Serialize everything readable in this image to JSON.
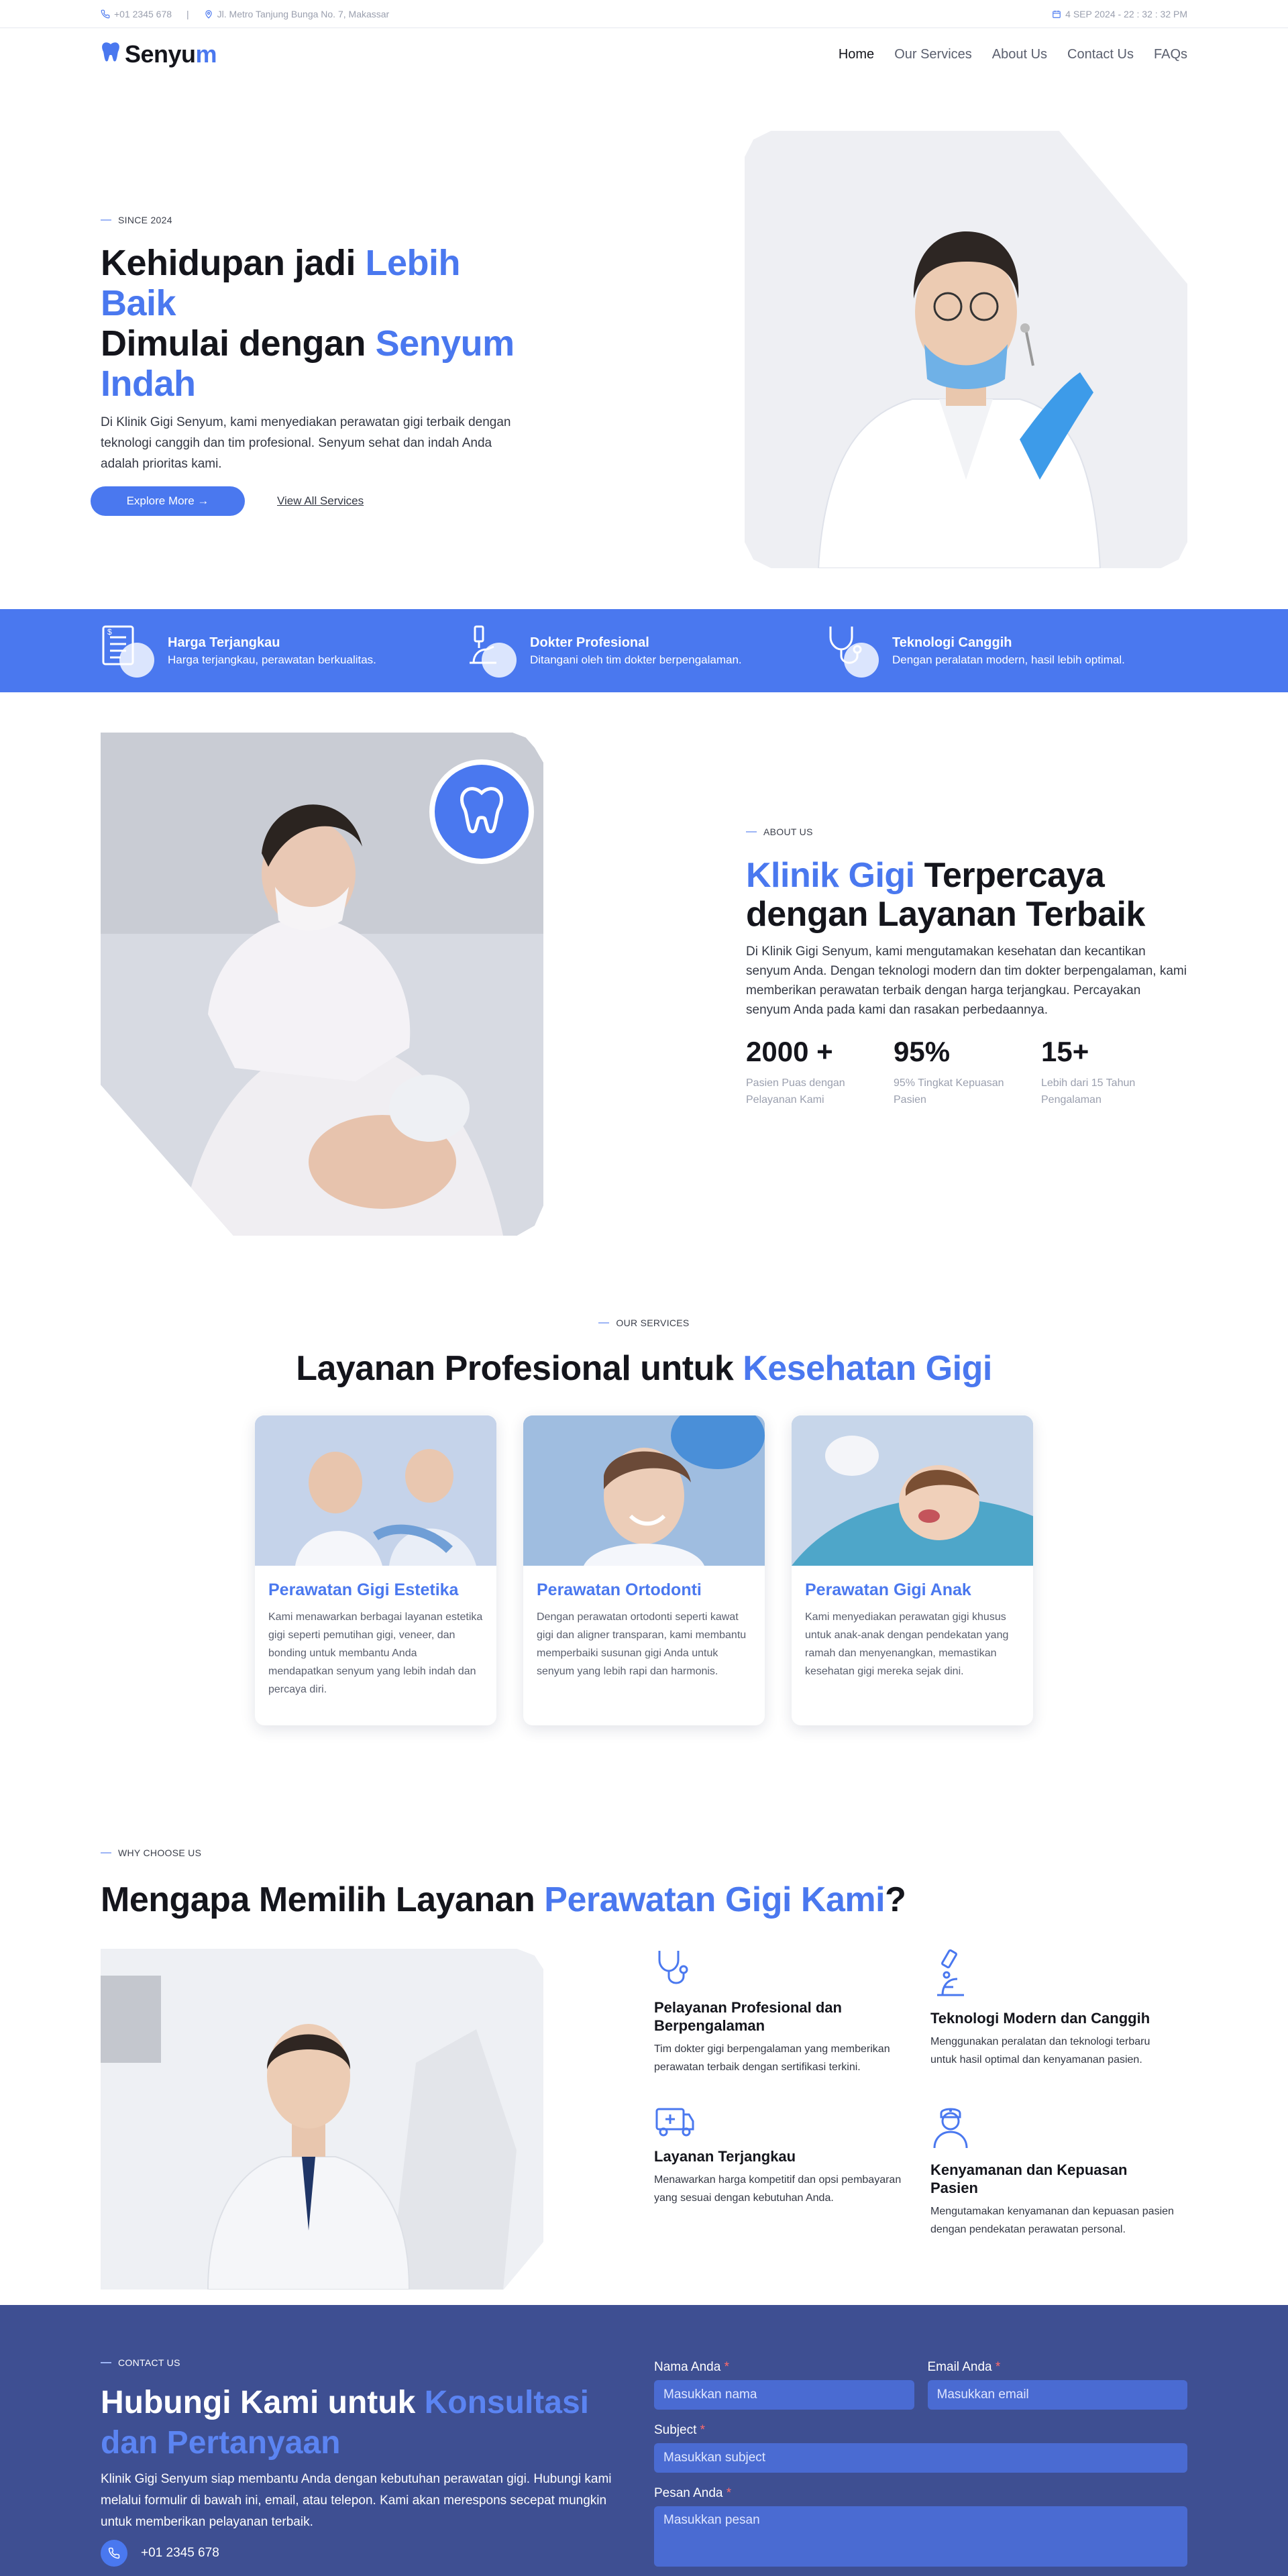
{
  "topbar": {
    "phone": "+01 2345 678",
    "address": "Jl. Metro Tanjung Bunga No. 7, Makassar",
    "datetime": "4 SEP 2024 - 22 : 32 : 32 PM"
  },
  "brand": {
    "name_prefix": "Senyu",
    "name_suffix": "m"
  },
  "nav": {
    "items": [
      "Home",
      "Our Services",
      "About Us",
      "Contact Us",
      "FAQs"
    ]
  },
  "hero": {
    "eyebrow": "SINCE 2024",
    "title_1": "Kehidupan jadi ",
    "title_2": "Lebih Baik",
    "title_3": "Dimulai dengan ",
    "title_4": "Senyum Indah",
    "description": "Di Klinik Gigi Senyum, kami menyediakan perawatan gigi terbaik dengan teknologi canggih dan tim profesional. Senyum sehat dan indah Anda adalah prioritas kami.",
    "primary_button": "Explore More →",
    "secondary_link": "View All Services"
  },
  "features": [
    {
      "title": "Harga Terjangkau",
      "desc": "Harga terjangkau, perawatan berkualitas."
    },
    {
      "title": "Dokter Profesional",
      "desc": "Ditangani oleh tim dokter berpengalaman."
    },
    {
      "title": "Teknologi Canggih",
      "desc": "Dengan peralatan modern, hasil lebih optimal."
    }
  ],
  "about": {
    "eyebrow": "ABOUT US",
    "title_1": "Klinik Gigi",
    "title_2": " Terpercaya dengan Layanan Terbaik",
    "description": "Di Klinik Gigi Senyum, kami mengutamakan kesehatan dan kecantikan senyum Anda. Dengan teknologi modern dan tim dokter berpengalaman, kami memberikan perawatan terbaik dengan harga terjangkau. Percayakan senyum Anda pada kami dan rasakan perbedaannya.",
    "stats": [
      {
        "value": "2000 +",
        "label": "Pasien Puas dengan Pelayanan Kami"
      },
      {
        "value": "95%",
        "label": "95% Tingkat Kepuasan Pasien"
      },
      {
        "value": "15+",
        "label": "Lebih dari 15 Tahun Pengalaman"
      }
    ]
  },
  "services": {
    "eyebrow": "OUR SERVICES",
    "title_1": "Layanan Profesional untuk ",
    "title_2": "Kesehatan Gigi",
    "cards": [
      {
        "title": "Perawatan Gigi Estetika",
        "desc": "Kami menawarkan berbagai layanan estetika gigi seperti pemutihan gigi, veneer, dan bonding untuk membantu Anda mendapatkan senyum yang lebih indah dan percaya diri."
      },
      {
        "title": "Perawatan Ortodonti",
        "desc": "Dengan perawatan ortodonti seperti kawat gigi dan aligner transparan, kami membantu memperbaiki susunan gigi Anda untuk senyum yang lebih rapi dan harmonis."
      },
      {
        "title": "Perawatan Gigi Anak",
        "desc": "Kami menyediakan perawatan gigi khusus untuk anak-anak dengan pendekatan yang ramah dan menyenangkan, memastikan kesehatan gigi mereka sejak dini."
      }
    ]
  },
  "why": {
    "eyebrow": "WHY CHOOSE US",
    "title_1": "Mengapa Memilih Layanan ",
    "title_2": "Perawatan Gigi Kami",
    "title_3": "?",
    "items": [
      {
        "title": "Pelayanan Profesional dan Berpengalaman",
        "desc": "Tim dokter gigi berpengalaman yang memberikan perawatan terbaik dengan sertifikasi terkini."
      },
      {
        "title": "Teknologi Modern dan Canggih",
        "desc": "Menggunakan peralatan dan teknologi terbaru untuk hasil optimal dan kenyamanan pasien."
      },
      {
        "title": "Layanan Terjangkau",
        "desc": "Menawarkan harga kompetitif dan opsi pembayaran yang sesuai dengan kebutuhan Anda."
      },
      {
        "title": "Kenyamanan dan Kepuasan Pasien",
        "desc": "Mengutamakan kenyamanan dan kepuasan pasien dengan pendekatan perawatan personal."
      }
    ]
  },
  "contact": {
    "eyebrow": "CONTACT US",
    "title_1": "Hubungi Kami untuk ",
    "title_2": "Konsultasi dan Pertanyaan",
    "description": "Klinik Gigi Senyum siap membantu Anda dengan kebutuhan perawatan gigi. Hubungi kami melalui formulir di bawah ini, email, atau telepon. Kami akan merespons secepat mungkin untuk memberikan pelayanan terbaik.",
    "phone": "+01 2345 678",
    "form": {
      "name_label": "Nama Anda",
      "name_placeholder": "Masukkan nama",
      "email_label": "Email Anda",
      "email_placeholder": "Masukkan email",
      "subject_label": "Subject",
      "subject_placeholder": "Masukkan subject",
      "message_label": "Pesan Anda",
      "message_placeholder": "Masukkan pesan",
      "required_mark": "*"
    }
  },
  "colors": {
    "accent": "#4a78ef",
    "contact_bg": "#3e4f92",
    "text_dark": "#14151c"
  },
  "icons": [
    "phone-icon",
    "location-pin-icon",
    "calendar-icon",
    "tooth-logo-icon",
    "price-document-icon",
    "microscope-icon",
    "stethoscope-icon",
    "tooth-icon",
    "medical-case-icon",
    "nurse-icon"
  ]
}
